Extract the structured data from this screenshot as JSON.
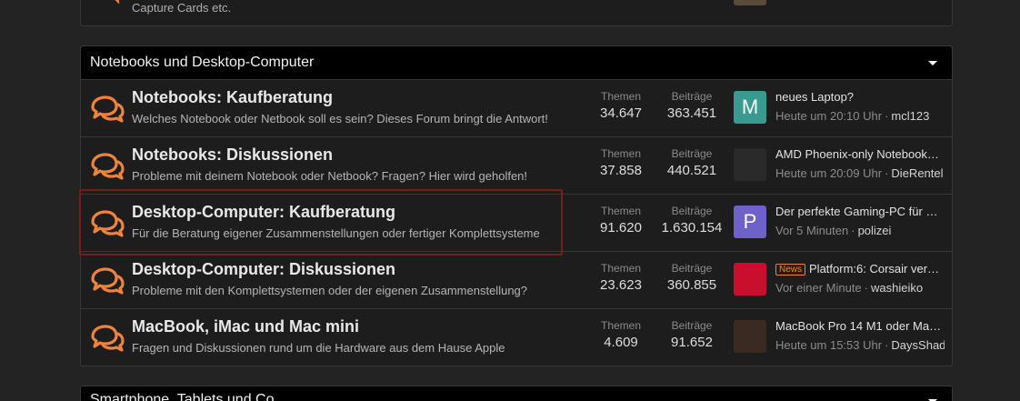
{
  "previous_category": {
    "node_description": "Capture Cards etc."
  },
  "category": {
    "title": "Notebooks und Desktop-Computer",
    "nodes": [
      {
        "title": "Notebooks: Kaufberatung",
        "description": "Welches Notebook oder Netbook soll es sein? Dieses Forum bringt die Antwort!",
        "themes_label": "Themen",
        "themes": "34.647",
        "posts_label": "Beiträge",
        "posts": "363.451",
        "last_post": {
          "avatar_letter": "M",
          "avatar_color": "#3a9a92",
          "title": "neues Laptop?",
          "time": "Heute um 20:10 Uhr",
          "user": "mcl123"
        }
      },
      {
        "title": "Notebooks: Diskussionen",
        "description": "Probleme mit deinem Notebook oder Netbook? Fragen? Hier wird geholfen!",
        "themes_label": "Themen",
        "themes": "37.858",
        "posts_label": "Beiträge",
        "posts": "440.521",
        "last_post": {
          "avatar_letter": "",
          "avatar_color": "#2a2a2a",
          "title": "AMD Phoenix-only Notebook…",
          "time": "Heute um 20:09 Uhr",
          "user": "DieRentel"
        }
      },
      {
        "title": "Desktop-Computer: Kaufberatung",
        "description": "Für die Beratung eigener Zusammenstellungen oder fertiger Komplettsysteme",
        "themes_label": "Themen",
        "themes": "91.620",
        "posts_label": "Beiträge",
        "posts": "1.630.154",
        "last_post": {
          "avatar_letter": "P",
          "avatar_color": "#6e62c8",
          "title": "Der perfekte Gaming-PC für …",
          "time": "Vor 5 Minuten",
          "user": "polizei"
        }
      },
      {
        "title": "Desktop-Computer: Diskussionen",
        "description": "Probleme mit den Komplettsystemen oder der eigenen Zusammenstellung?",
        "themes_label": "Themen",
        "themes": "23.623",
        "posts_label": "Beiträge",
        "posts": "360.855",
        "last_post": {
          "avatar_letter": "",
          "avatar_color": "#c8102e",
          "badge": "News",
          "title": "Platform:6: Corsair ver…",
          "time": "Vor einer Minute",
          "user": "washieiko"
        }
      },
      {
        "title": "MacBook, iMac und Mac mini",
        "description": "Fragen und Diskussionen rund um die Hardware aus dem Hause Apple",
        "themes_label": "Themen",
        "themes": "4.609",
        "posts_label": "Beiträge",
        "posts": "91.652",
        "last_post": {
          "avatar_letter": "",
          "avatar_color": "#3a2a22",
          "title": "MacBook Pro 14 M1 oder Ma…",
          "time": "Heute um 15:53 Uhr",
          "user": "DaysShad"
        }
      }
    ]
  },
  "next_category": {
    "title": "Smartphone, Tablets und Co."
  },
  "colors": {
    "accent": "#f0833a",
    "highlight_border": "#7a1c1c"
  }
}
